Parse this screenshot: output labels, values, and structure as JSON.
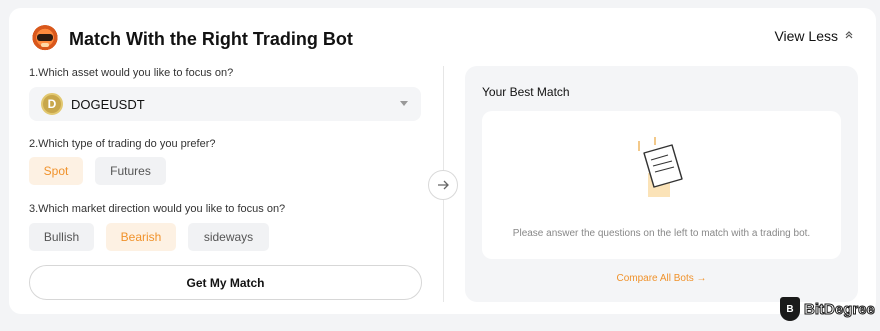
{
  "header": {
    "title": "Match With the Right Trading Bot",
    "view_less": "View Less",
    "bot_icon": "robot-icon",
    "chevron_icon": "chevron-up-icon"
  },
  "questions": {
    "q1": "1.Which asset would you like to focus on?",
    "q2": "2.Which type of trading do you prefer?",
    "q3": "3.Which market direction would you like to focus on?"
  },
  "asset_select": {
    "value": "DOGEUSDT",
    "coin_glyph": "D",
    "icon": "doge-coin-icon"
  },
  "trading_types": [
    "Spot",
    "Futures"
  ],
  "trading_type_selected": "Spot",
  "directions": [
    "Bullish",
    "Bearish",
    "sideways"
  ],
  "direction_selected": "Bearish",
  "get_match_label": "Get My Match",
  "result": {
    "title": "Your Best Match",
    "hint": "Please answer the questions on the left to match with a trading bot.",
    "compare_link": "Compare All Bots →"
  },
  "watermark": {
    "text": "BitDegree",
    "glyph": "B"
  },
  "colors": {
    "accent": "#f0922b",
    "accent_bg": "#fdf1e3",
    "chip_bg": "#f1f2f4",
    "panel_bg": "#f4f5f7"
  }
}
